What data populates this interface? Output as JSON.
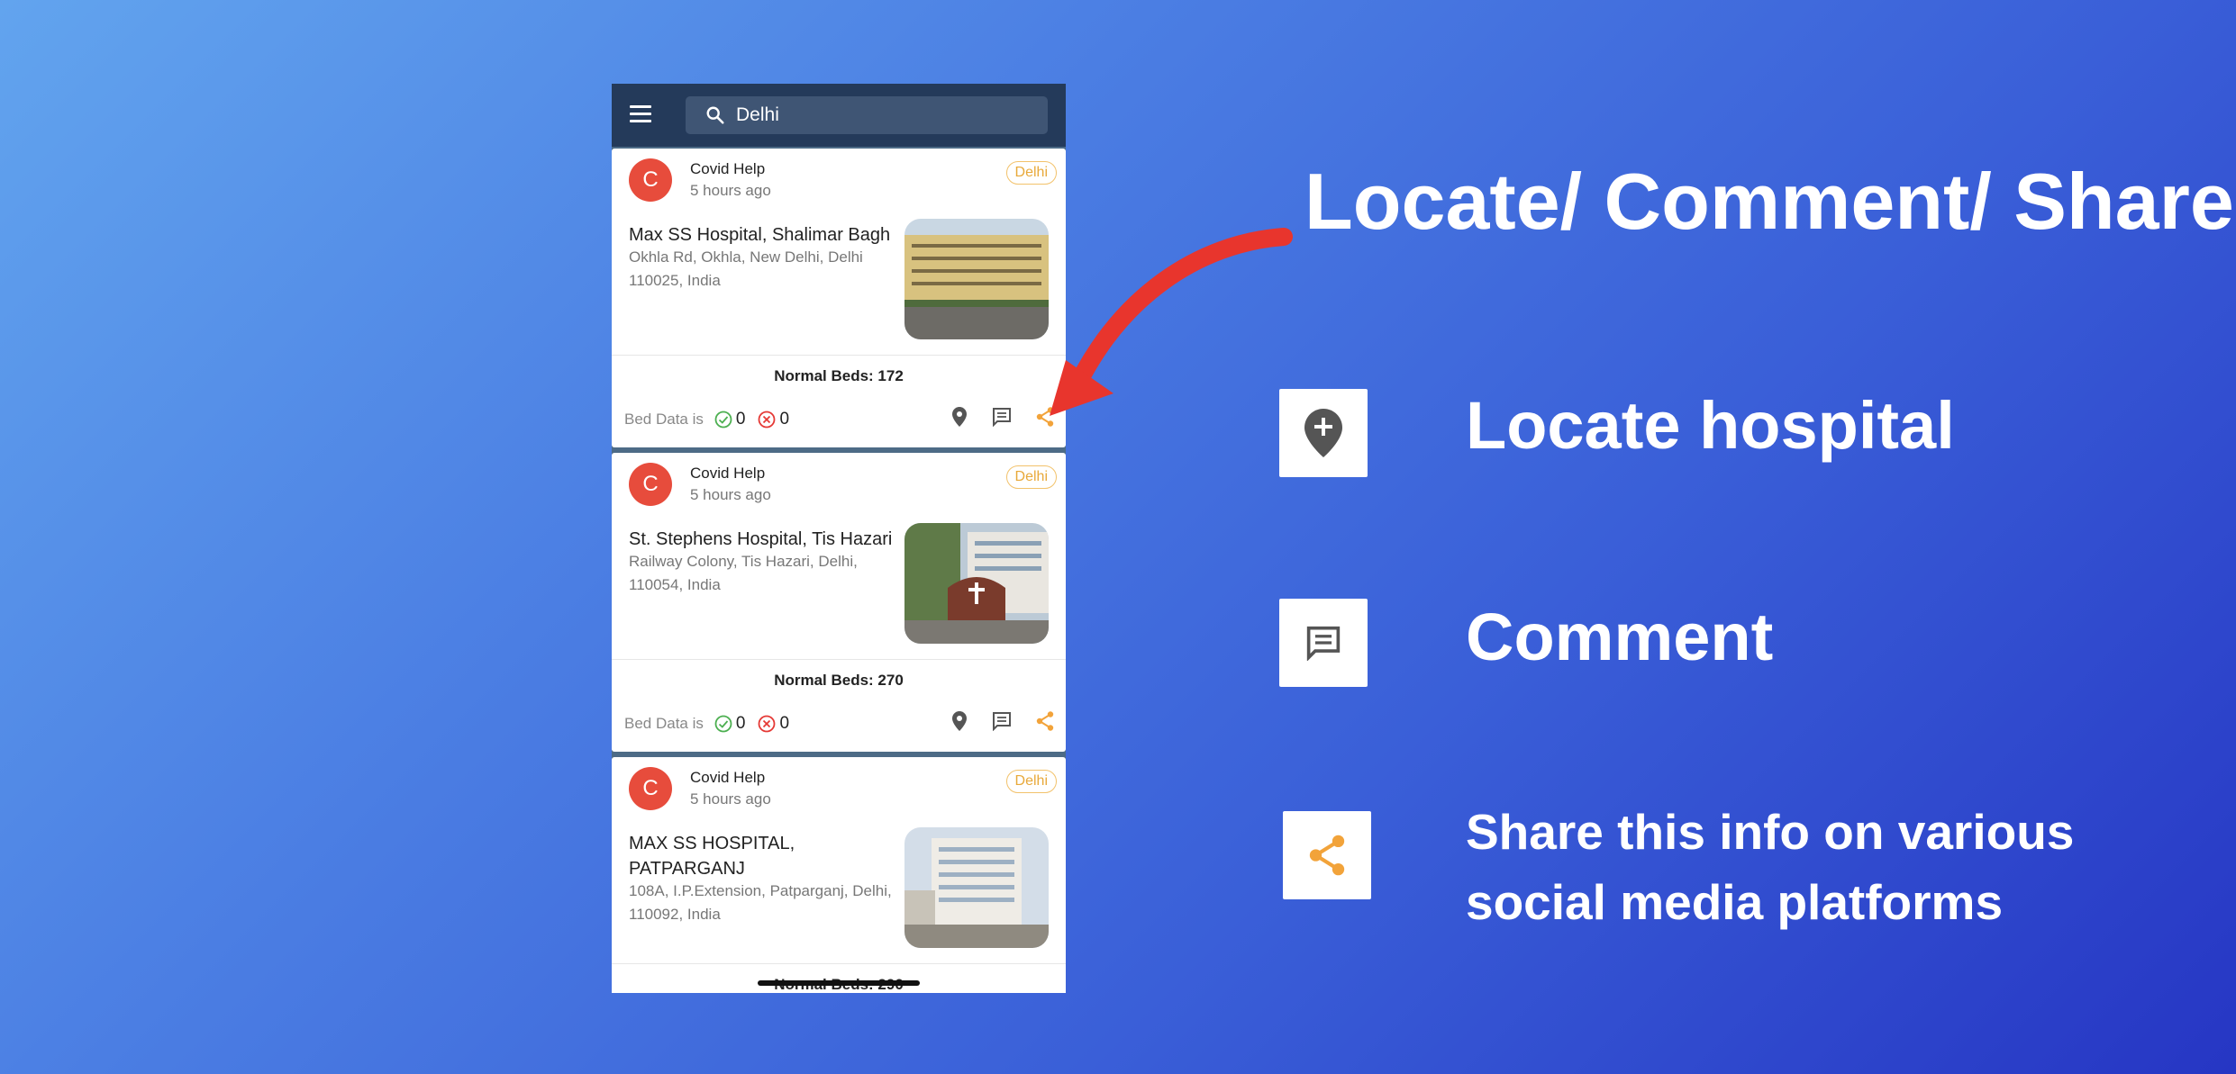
{
  "headline": "Locate/ Comment/ Share",
  "search": {
    "value": "Delhi"
  },
  "cards": [
    {
      "avatar": "C",
      "author": "Covid Help",
      "time": "5 hours ago",
      "tag": "Delhi",
      "hospital": "Max SS Hospital, Shalimar Bagh",
      "address": "Okhla Rd, Okhla, New Delhi, Delhi 110025, India",
      "beds": "Normal Beds: 172",
      "bed_label": "Bed Data is",
      "yes_count": "0",
      "no_count": "0"
    },
    {
      "avatar": "C",
      "author": "Covid Help",
      "time": "5 hours ago",
      "tag": "Delhi",
      "hospital": "St. Stephens Hospital, Tis Hazari",
      "address": "Railway Colony, Tis Hazari, Delhi, 110054, India",
      "beds": "Normal Beds: 270",
      "bed_label": "Bed Data is",
      "yes_count": "0",
      "no_count": "0"
    },
    {
      "avatar": "C",
      "author": "Covid Help",
      "time": "5 hours ago",
      "tag": "Delhi",
      "hospital": "MAX SS HOSPITAL, PATPARGANJ",
      "address": "108A, I.P.Extension, Patparganj, Delhi, 110092, India",
      "beds": "Normal Beds: 290"
    }
  ],
  "features": [
    {
      "icon": "add-location-icon",
      "label": "Locate hospital"
    },
    {
      "icon": "comment-icon",
      "label": "Comment"
    },
    {
      "icon": "share-icon",
      "label": "Share this info on various social media platforms"
    }
  ],
  "colors": {
    "accent_orange": "#f2a33a",
    "avatar_red": "#e74c3c",
    "topbar": "#243a5a",
    "arrow_red": "#e8352d"
  }
}
